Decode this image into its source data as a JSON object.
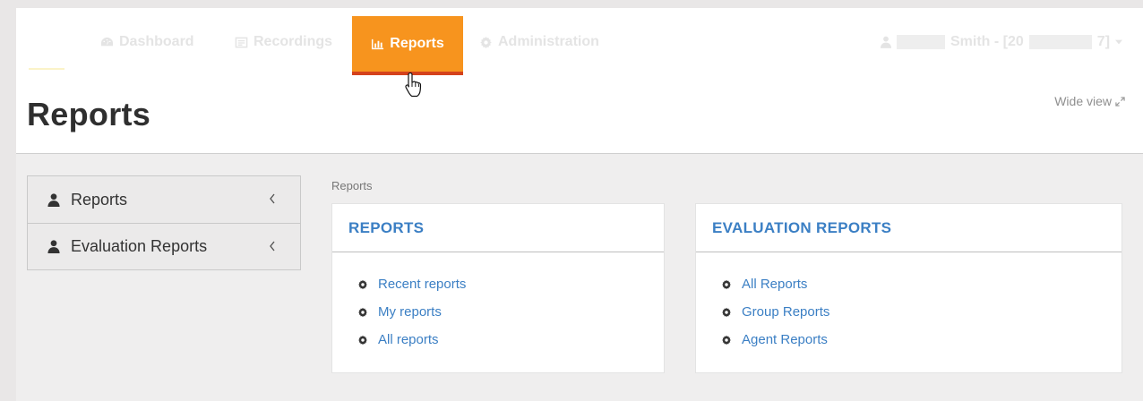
{
  "nav": {
    "items": [
      {
        "label": "Dashboard",
        "icon": "dashboard-icon"
      },
      {
        "label": "Recordings",
        "icon": "recordings-icon"
      },
      {
        "label": "Reports",
        "icon": "bar-chart-icon",
        "active": true
      },
      {
        "label": "Administration",
        "icon": "gear-icon"
      }
    ],
    "user": {
      "name_part1": "Smith - [20",
      "name_part2": "7]"
    }
  },
  "colors": {
    "accent": "#f7941e",
    "accent_border": "#d4421c",
    "link": "#3b7fc4"
  },
  "page": {
    "title": "Reports",
    "wide_view_label": "Wide view",
    "breadcrumb": "Reports"
  },
  "sidebar": {
    "items": [
      {
        "label": "Reports"
      },
      {
        "label": "Evaluation Reports"
      }
    ]
  },
  "panels": [
    {
      "title": "REPORTS",
      "links": [
        "Recent reports",
        "My reports",
        "All reports"
      ]
    },
    {
      "title": "EVALUATION REPORTS",
      "links": [
        "All Reports",
        "Group Reports",
        "Agent Reports"
      ]
    }
  ]
}
